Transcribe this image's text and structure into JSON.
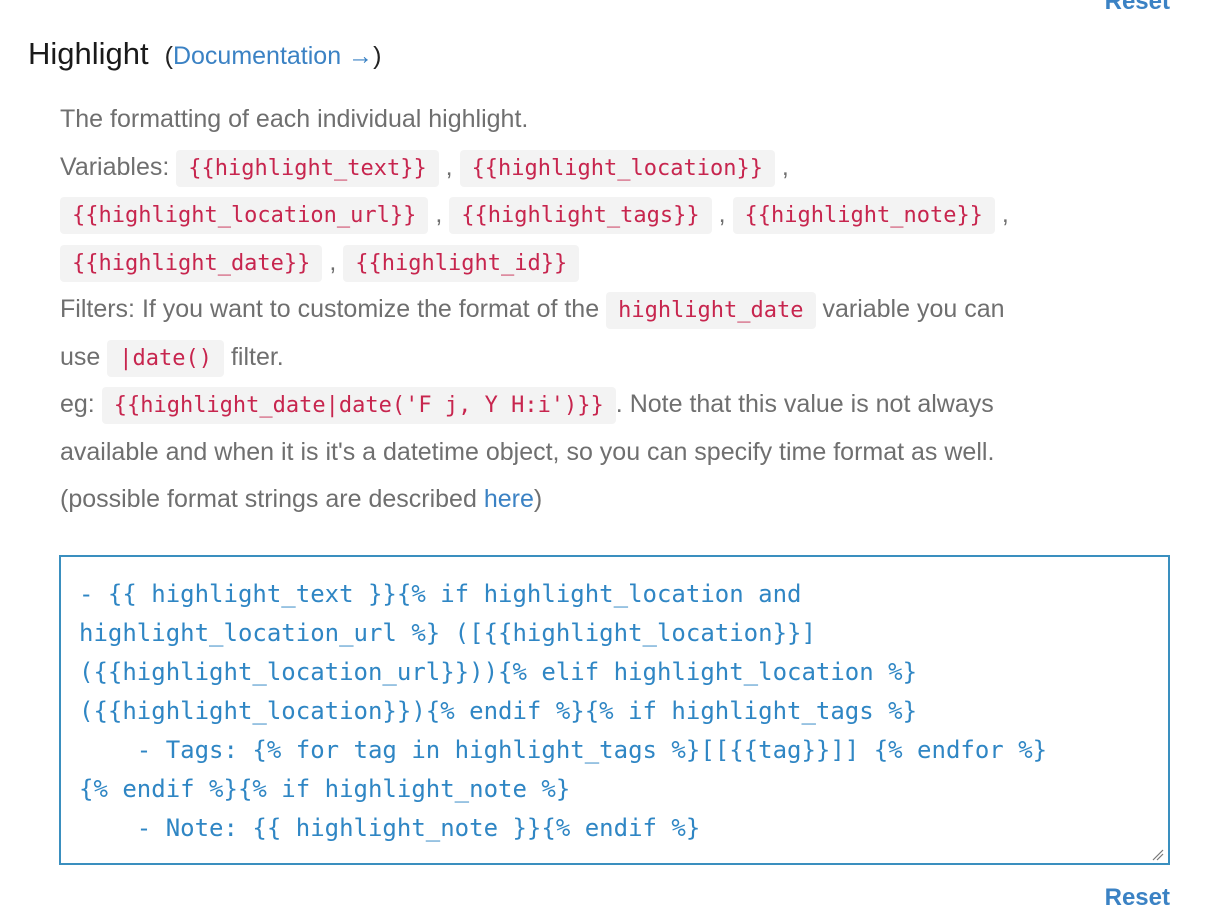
{
  "header": {
    "reset_label": "Reset",
    "title": "Highlight",
    "doc_open": "(",
    "doc_link": "Documentation →",
    "doc_close": ")"
  },
  "description": {
    "line1": "The formatting of each individual highlight.",
    "variables_label": "Variables:",
    "vars": [
      "{{highlight_text}}",
      "{{highlight_location}}",
      "{{highlight_location_url}}",
      "{{highlight_tags}}",
      "{{highlight_note}}",
      "{{highlight_date}}",
      "{{highlight_id}}"
    ],
    "sep": ",",
    "filters_text": "Filters: If you want to customize the format of the",
    "filters_var": "highlight_date",
    "filters_tail": "variable you can",
    "use_text": "use",
    "date_filter": "|date()",
    "filter_word": "filter.",
    "eg_label": "eg:",
    "eg_code": "{{highlight_date|date('F j, Y H:i')}}",
    "eg_note": ". Note that this value is not always",
    "line_available": "available and when it is it's a datetime object, so you can specify time format as well.",
    "possible_open": "(possible format strings are described",
    "here_link": "here",
    "possible_close": ")"
  },
  "editor": {
    "value": "- {{ highlight_text }}{% if highlight_location and\nhighlight_location_url %} ([{{highlight_location}}]\n({{highlight_location_url}})){% elif highlight_location %}\n({{highlight_location}}){% endif %}{% if highlight_tags %}\n    - Tags: {% for tag in highlight_tags %}[[{{tag}}]] {% endfor %}\n{% endif %}{% if highlight_note %}\n    - Note: {{ highlight_note }}{% endif %}"
  },
  "footer": {
    "reset_label": "Reset"
  },
  "colors": {
    "link": "#3b82c4",
    "code_text": "#c7254e",
    "code_bg": "#f3f3f3",
    "editor_text": "#2f86c4",
    "editor_border": "#3a8fbf"
  }
}
